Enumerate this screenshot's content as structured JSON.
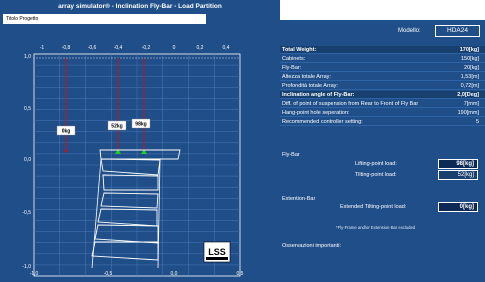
{
  "window": {
    "title": "array simulator® - Inclination Fly-Bar - Load Partition"
  },
  "project": {
    "label": "Titolo Progetto"
  },
  "model": {
    "label": "Modello:",
    "value": "HDA24"
  },
  "summary": {
    "rows": [
      {
        "label": "Total Weight:",
        "value": "170[kg]"
      },
      {
        "label": "Cabinets:",
        "value": "150[kg]"
      },
      {
        "label": "Fly-Bar:",
        "value": "20[kg]"
      },
      {
        "label": "Altezza totale Array:",
        "value": "1,53[m]"
      },
      {
        "label": "Profondità totale Array:",
        "value": "0,72[m]"
      },
      {
        "label": "Inclination angle of Fly-Bar:",
        "value": "2,0[Deg]"
      },
      {
        "label": "Diff. of point of suspension from Rear to Front of Fly Bar",
        "value": "7[mm]"
      },
      {
        "label": "Hang-point hole seperation:",
        "value": "190[mm]"
      },
      {
        "label": "Recommended controller setting:",
        "value": "5"
      }
    ]
  },
  "flybar": {
    "section": "Fly-Bar",
    "lifting_label": "Lifting-point load:",
    "lifting_value": "98[kg]",
    "tilting_label": "Tilting-point load:",
    "tilting_value": "52[kg]"
  },
  "extbar": {
    "section": "Extention-Bar",
    "ext_label": "Extended Tilting-point load:",
    "ext_value": "0[kg]",
    "note": "*Fly-Frame and/or Extension-Bar excluded"
  },
  "observations": {
    "label": "Osservazioni importanti:"
  },
  "chart_data": {
    "type": "diagram",
    "x_ticks_top": [
      "-1",
      "-0,8",
      "-0,6",
      "-0,4",
      "-0,2",
      "0",
      "0,2",
      "0,4"
    ],
    "x_ticks_bottom": [
      "-1,0",
      "-0,5",
      "0,0",
      "0,5"
    ],
    "y_ticks": [
      "1,0",
      "0,5",
      "0,0",
      "-0,5",
      "-1,0"
    ],
    "load_labels": [
      {
        "text": "0kg",
        "color": "#cc1111"
      },
      {
        "text": "52kg",
        "color": "#cc1111"
      },
      {
        "text": "98kg",
        "color": "#cc1111"
      }
    ],
    "colors": {
      "background": "#1f4e89",
      "grid": "#4a78b5",
      "load": "#cc1111",
      "hangpoint": "#22cc22",
      "cabinet": "#ffffff"
    }
  },
  "logo": {
    "text": "LSS"
  }
}
